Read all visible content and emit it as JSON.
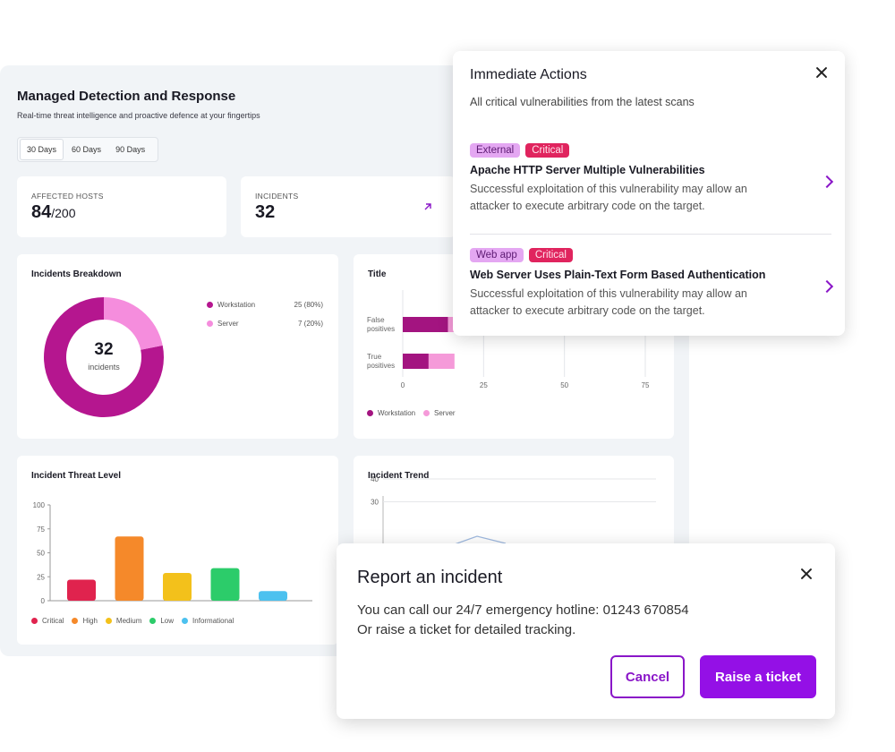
{
  "dashboard": {
    "title": "Managed Detection and Response",
    "subtitle": "Real-time threat intelligence and proactive defence at your fingertips",
    "range_tabs": [
      "30 Days",
      "60 Days",
      "90 Days"
    ],
    "active_range": "30 Days",
    "kpis": {
      "affected_hosts": {
        "label": "AFFECTED HOSTS",
        "value": "84",
        "total": "/200"
      },
      "incidents": {
        "label": "INCIDENTS",
        "value": "32"
      }
    }
  },
  "breakdown": {
    "title": "Incidents Breakdown",
    "center_value": "32",
    "center_label": "incidents",
    "legend": [
      {
        "label": "Workstation",
        "value": "25 (80%)",
        "color": "#b5168f"
      },
      {
        "label": "Server",
        "value": "7 (20%)",
        "color": "#f58ddd"
      }
    ]
  },
  "positives": {
    "title": "Title",
    "legend": [
      "Workstation",
      "Server"
    ]
  },
  "threat_level": {
    "title": "Incident Threat Level",
    "legend": [
      "Critical",
      "High",
      "Medium",
      "Low",
      "Informational"
    ]
  },
  "trend": {
    "title": "Incident Trend"
  },
  "chart_data": [
    {
      "type": "pie",
      "title": "Incidents Breakdown",
      "categories": [
        "Workstation",
        "Server"
      ],
      "values": [
        25,
        7
      ],
      "colors": [
        "#b5168f",
        "#f58ddd"
      ],
      "donut": true
    },
    {
      "type": "bar",
      "orientation": "horizontal",
      "stacked": true,
      "title": "Title",
      "categories": [
        "False positives",
        "True positives"
      ],
      "series": [
        {
          "name": "Workstation",
          "values": [
            14,
            8
          ],
          "color": "#a31480"
        },
        {
          "name": "Server",
          "values": [
            25,
            8
          ],
          "color": "#f59ad9"
        }
      ],
      "xlim": [
        0,
        75
      ],
      "xticks": [
        0,
        25,
        50,
        75
      ],
      "grid": true,
      "legend": "bottom-left"
    },
    {
      "type": "bar",
      "title": "Incident Threat Level",
      "categories": [
        "Critical",
        "High",
        "Medium",
        "Low",
        "Informational"
      ],
      "values": [
        22,
        67,
        29,
        34,
        10
      ],
      "colors": [
        "#e0234e",
        "#f5892a",
        "#f3c11b",
        "#2ccc6a",
        "#4cc1ef"
      ],
      "ylim": [
        0,
        100
      ],
      "yticks": [
        0,
        25,
        50,
        75,
        100
      ],
      "legend": "bottom-left"
    },
    {
      "type": "line",
      "title": "Incident Trend",
      "ylim": [
        0,
        40
      ],
      "yticks": [
        30,
        40
      ],
      "grid": true
    }
  ],
  "immediate_actions": {
    "title": "Immediate Actions",
    "subtitle": "All critical vulnerabilities from the latest scans",
    "items": [
      {
        "tags": [
          "External",
          "Critical"
        ],
        "title": "Apache HTTP Server Multiple Vulnerabilities",
        "description": "Successful exploitation of this vulnerability may allow an attacker to execute arbitrary code on the target."
      },
      {
        "tags": [
          "Web app",
          "Critical"
        ],
        "title": "Web Server Uses Plain-Text Form Based Authentication",
        "description": "Successful exploitation of this vulnerability may allow an attacker to execute arbitrary code on the target."
      }
    ]
  },
  "report": {
    "title": "Report an incident",
    "line1": "You can call our 24/7 emergency hotline: 01243 670854",
    "line2": "Or raise a ticket for detailed tracking.",
    "cancel_label": "Cancel",
    "raise_label": "Raise a ticket"
  },
  "colors": {
    "accent": "#9410e6",
    "critical_tag": "#e0245e",
    "external_tag": "#e4a7f2"
  }
}
